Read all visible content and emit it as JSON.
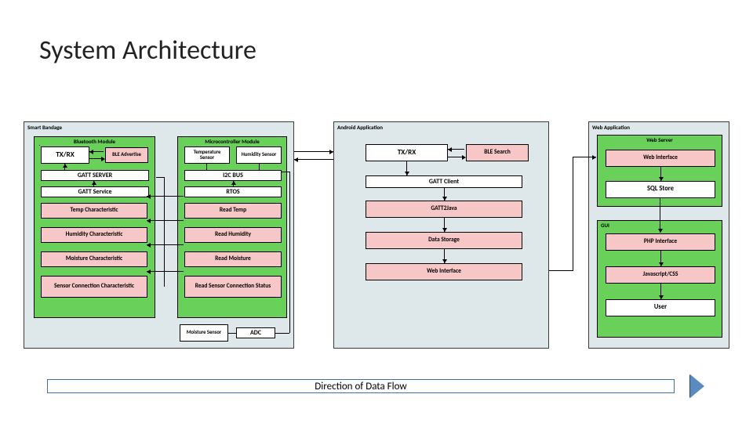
{
  "title": "System Architecture",
  "footer_arrow": "Direction of Data Flow",
  "panels": {
    "smart_bandage": {
      "label": "Smart Bandage",
      "bluetooth": {
        "label": "Bluetooth Module",
        "txrx": "TX/RX",
        "ble_advertise": "BLE Advertise",
        "gatt_server": "GATT SERVER",
        "gatt_service": "GATT Service",
        "temp_char": "Temp Characteristic",
        "humidity_char": "Humidity Characteristic",
        "moisture_char": "Moisture Characteristic",
        "sensor_conn_char": "Sensor Connection Characteristic"
      },
      "micro": {
        "label": "Microcontroller Module",
        "temp_sensor": "Temperature Sensor",
        "humidity_sensor": "Humidity Sensor",
        "i2c": "I2C BUS",
        "rtos": "RTOS",
        "read_temp": "Read Temp",
        "read_humidity": "Read Humidity",
        "read_moisture": "Read Moisture",
        "read_sensor_conn": "Read Sensor Connection Status",
        "moisture_sensor": "Moisture Sensor",
        "adc": "ADC"
      }
    },
    "android": {
      "label": "Android Application",
      "txrx": "TX/RX",
      "ble_search": "BLE Search",
      "gatt_client": "GATT Client",
      "gatt2java": "GATT2Java",
      "data_storage": "Data Storage",
      "web_interface": "Web Interface"
    },
    "web": {
      "label": "Web Application",
      "web_server": {
        "label": "Web Server",
        "web_interface": "Web Interface",
        "sql_store": "SQL Store"
      },
      "gui": {
        "label": "GUI",
        "php": "PHP Interface",
        "js": "Javascript/CSS",
        "user": "User"
      }
    }
  }
}
